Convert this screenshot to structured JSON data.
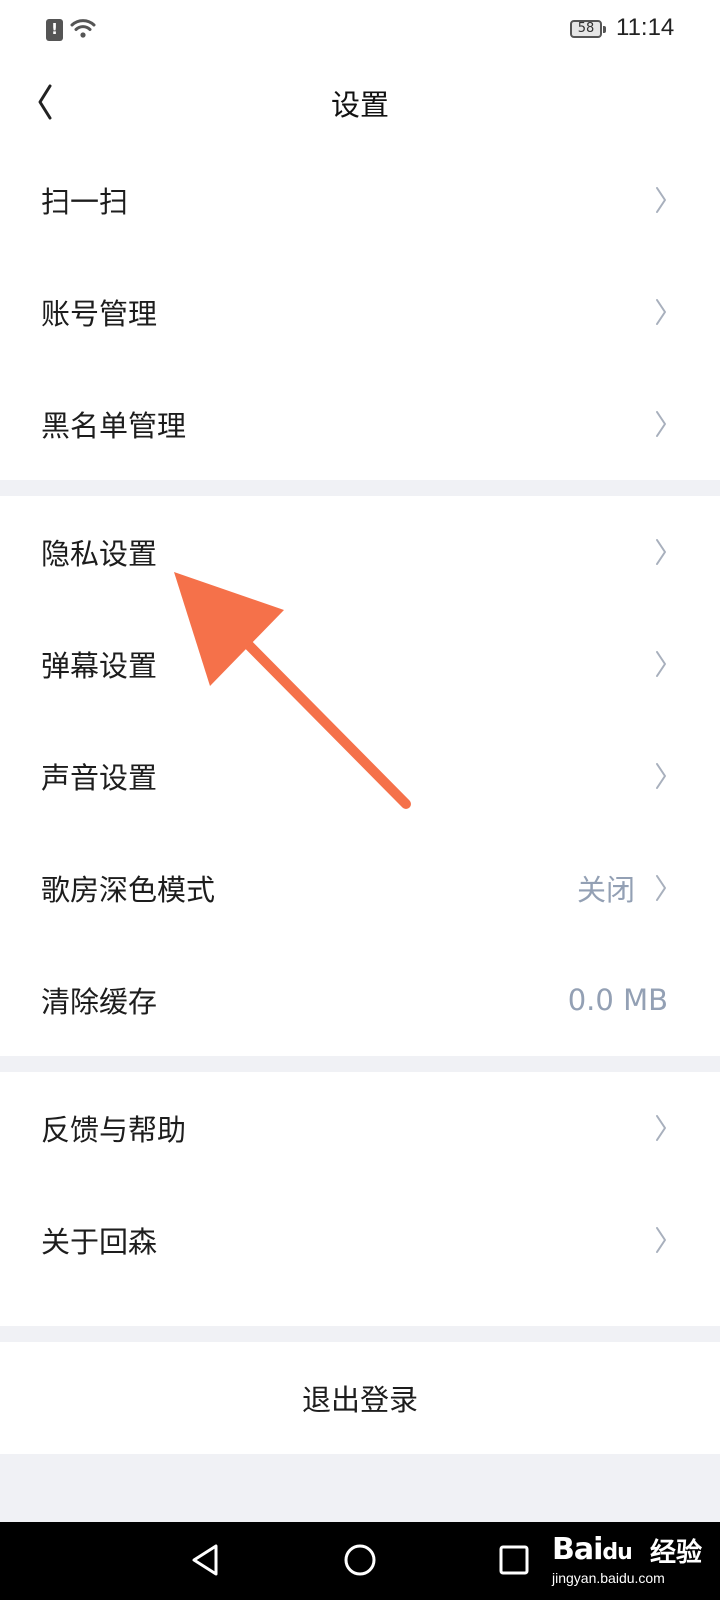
{
  "status_bar": {
    "battery": "58",
    "time": "11:14",
    "icons": [
      "alert-icon",
      "wifi-icon",
      "battery-icon"
    ]
  },
  "header": {
    "title": "设置",
    "back_icon": "chevron-left-icon"
  },
  "groups": [
    {
      "items": [
        {
          "label": "扫一扫"
        },
        {
          "label": "账号管理"
        },
        {
          "label": "黑名单管理"
        }
      ]
    },
    {
      "items": [
        {
          "label": "隐私设置"
        },
        {
          "label": "弹幕设置"
        },
        {
          "label": "声音设置"
        },
        {
          "label": "歌房深色模式",
          "value": "关闭"
        },
        {
          "label": "清除缓存",
          "value": "0.0 MB"
        }
      ]
    },
    {
      "items": [
        {
          "label": "反馈与帮助"
        },
        {
          "label": "关于回森"
        }
      ]
    }
  ],
  "logout": {
    "label": "退出登录"
  },
  "annotation": {
    "arrow_color": "#f5714a",
    "points_to": "隐私设置"
  },
  "system_nav": {
    "icons": [
      "back-triangle-icon",
      "home-circle-icon",
      "recents-square-icon"
    ]
  },
  "watermark": {
    "logo": "Bai",
    "logo_suffix": "du",
    "brand": "经验",
    "url": "jingyan.baidu.com"
  }
}
